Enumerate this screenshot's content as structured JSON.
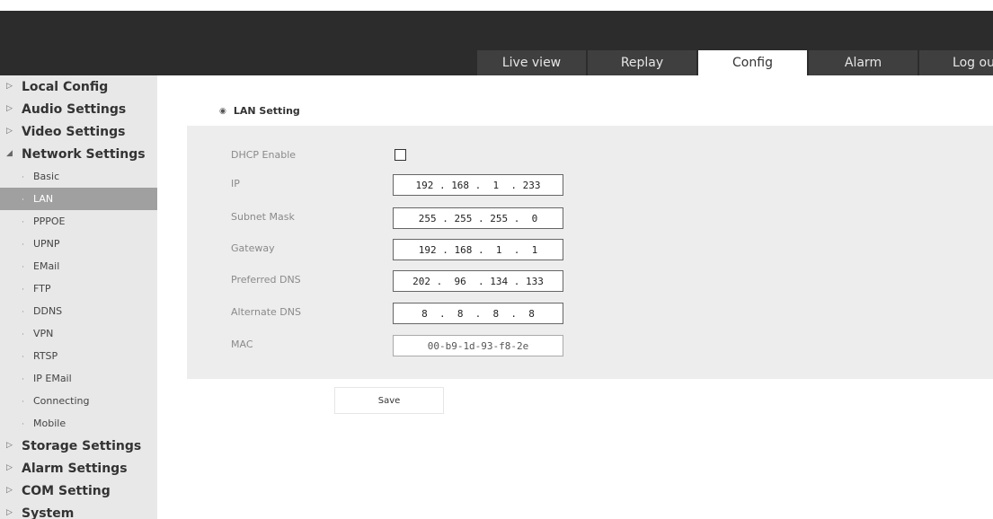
{
  "header": {
    "tabs": [
      {
        "label": "Live view",
        "active": false
      },
      {
        "label": "Replay",
        "active": false
      },
      {
        "label": "Config",
        "active": true
      },
      {
        "label": "Alarm",
        "active": false
      },
      {
        "label": "Log ou",
        "active": false
      }
    ]
  },
  "sidebar": {
    "groups_top": [
      {
        "label": "Local Config",
        "expanded": false
      },
      {
        "label": "Audio Settings",
        "expanded": false
      },
      {
        "label": "Video Settings",
        "expanded": false
      },
      {
        "label": "Network Settings",
        "expanded": true
      }
    ],
    "network_items": [
      {
        "label": "Basic"
      },
      {
        "label": "LAN"
      },
      {
        "label": "PPPOE"
      },
      {
        "label": "UPNP"
      },
      {
        "label": "EMail"
      },
      {
        "label": "FTP"
      },
      {
        "label": "DDNS"
      },
      {
        "label": "VPN"
      },
      {
        "label": "RTSP"
      },
      {
        "label": "IP EMail"
      },
      {
        "label": "Connecting"
      },
      {
        "label": "Mobile"
      }
    ],
    "active_item": "LAN",
    "groups_bottom": [
      {
        "label": "Storage Settings",
        "expanded": false
      },
      {
        "label": "Alarm Settings",
        "expanded": false
      },
      {
        "label": "COM Setting",
        "expanded": false
      },
      {
        "label": "System",
        "expanded": false
      }
    ]
  },
  "section": {
    "title": "LAN Setting"
  },
  "form": {
    "dhcp": {
      "label": "DHCP Enable",
      "checked": false
    },
    "ip": {
      "label": "IP",
      "value": "192 . 168 .  1  . 233"
    },
    "subnet": {
      "label": "Subnet Mask",
      "value": "255 . 255 . 255 .  0"
    },
    "gateway": {
      "label": "Gateway",
      "value": "192 . 168 .  1  .  1"
    },
    "dns1": {
      "label": "Preferred DNS",
      "value": "202 .  96  . 134 . 133"
    },
    "dns2": {
      "label": "Alternate DNS",
      "value": "8  .  8  .  8  .  8"
    },
    "mac": {
      "label": "MAC",
      "value": "00-b9-1d-93-f8-2e"
    }
  },
  "actions": {
    "save_label": "Save"
  },
  "icons": {
    "collapsed": "triangle-right-icon",
    "expanded": "triangle-down-icon",
    "sub_item": "dot-icon",
    "section": "bullet-icon"
  },
  "colors": {
    "header_bg": "#2c2c2c",
    "tab_bg": "#3f3f3f",
    "tab_active_bg": "#ffffff",
    "sidebar_bg": "#e8e8e8",
    "sidebar_active_bg": "#a0a0a0",
    "panel_bg": "#ededed"
  }
}
